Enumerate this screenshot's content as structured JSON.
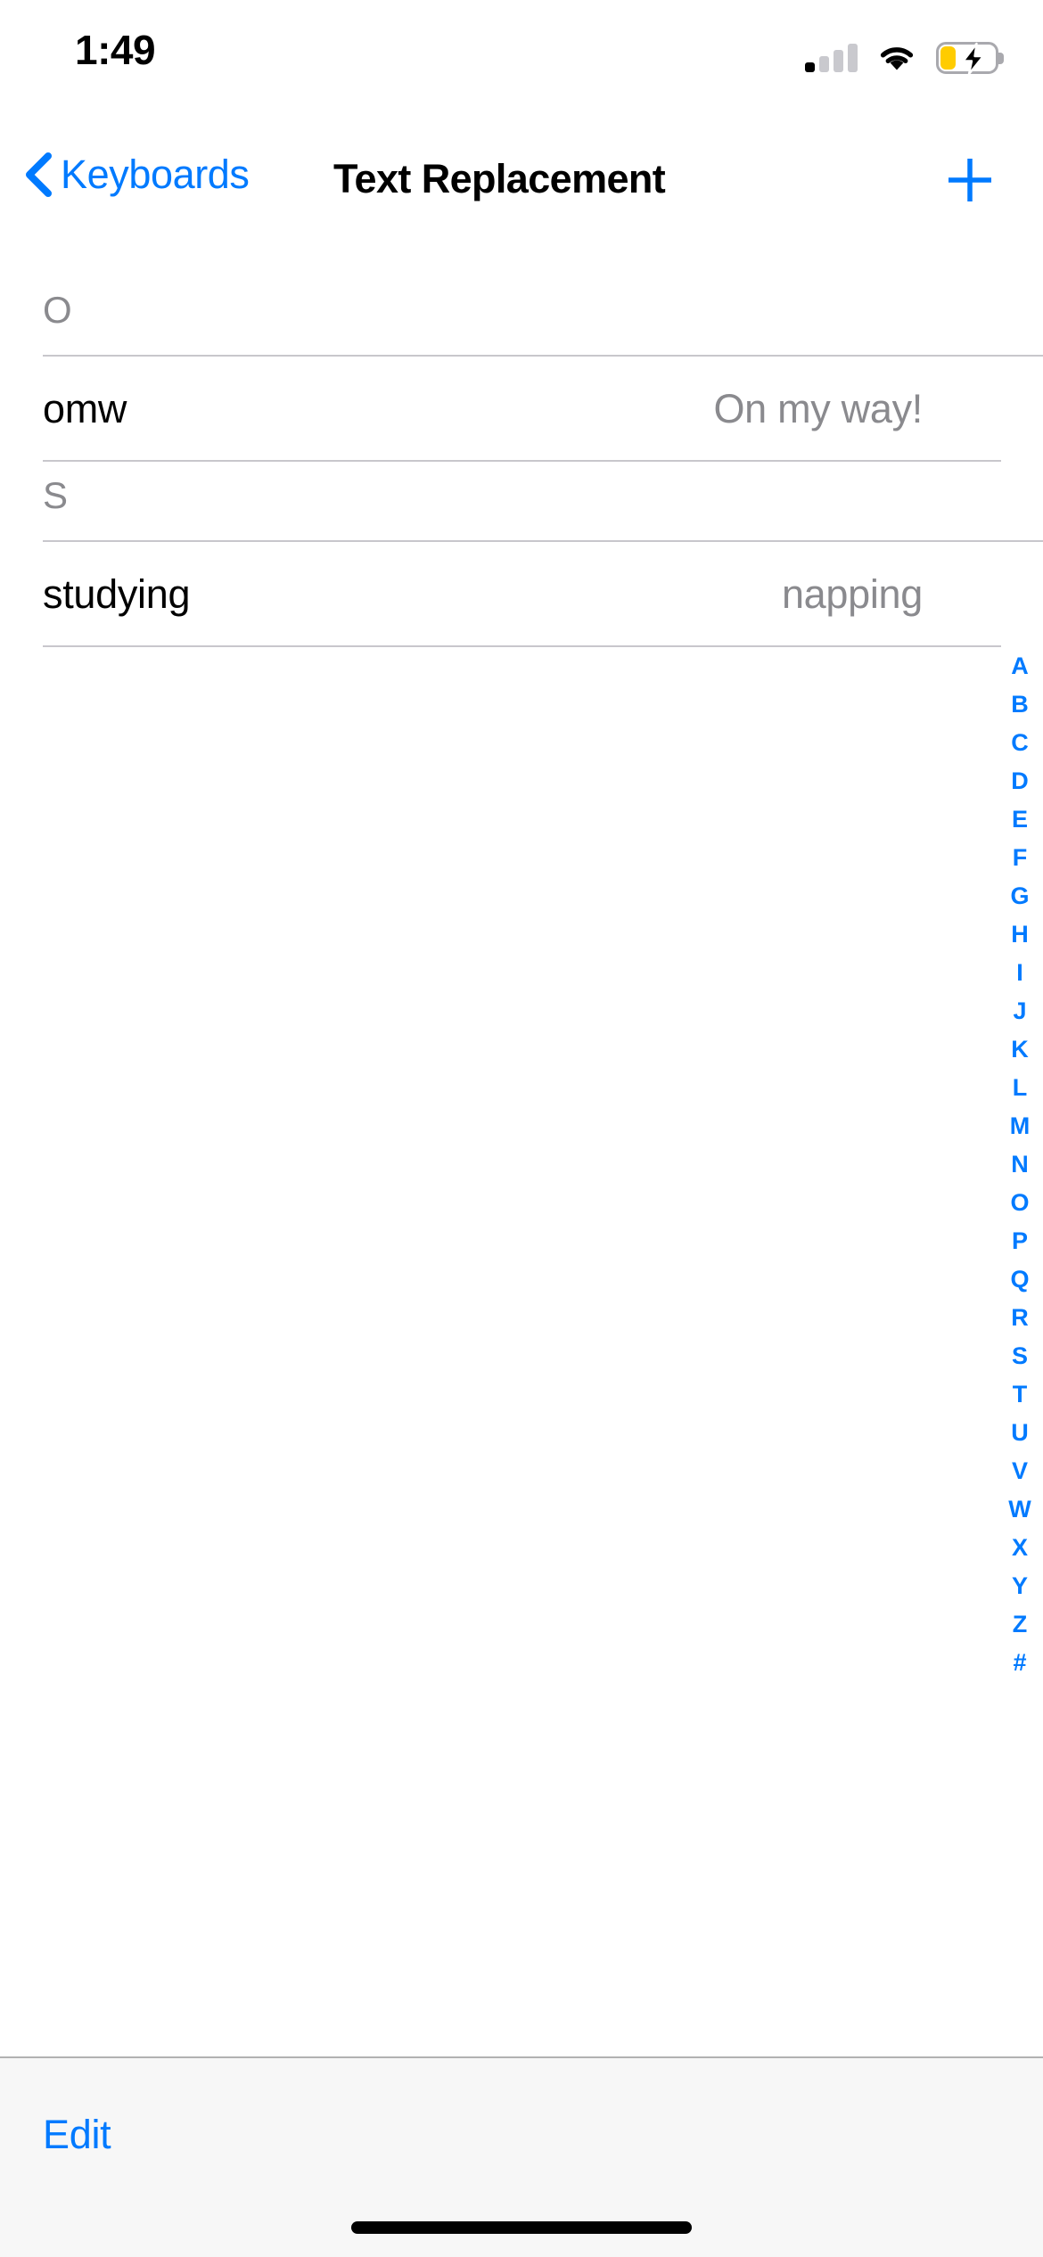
{
  "status_bar": {
    "time": "1:49",
    "cellular_icon": "cellular-signal-icon",
    "cellular_bars_filled": 1,
    "cellular_bars_total": 4,
    "wifi_icon": "wifi-icon",
    "battery_icon": "battery-charging-icon",
    "battery_low_power": true,
    "battery_fill_color": "#FFCC00",
    "battery_level_percent": 20
  },
  "nav": {
    "back_label": "Keyboards",
    "back_icon": "chevron-left-icon",
    "title": "Text Replacement",
    "add_icon": "plus-icon",
    "accent_color": "#007AFF"
  },
  "list": {
    "sections": [
      {
        "letter": "O",
        "rows": [
          {
            "shortcut": "omw",
            "phrase": "On my way!"
          }
        ]
      },
      {
        "letter": "S",
        "rows": [
          {
            "shortcut": "studying",
            "phrase": "napping"
          }
        ]
      }
    ]
  },
  "alpha_index": {
    "letters": [
      "A",
      "B",
      "C",
      "D",
      "E",
      "F",
      "G",
      "H",
      "I",
      "J",
      "K",
      "L",
      "M",
      "N",
      "O",
      "P",
      "Q",
      "R",
      "S",
      "T",
      "U",
      "V",
      "W",
      "X",
      "Y",
      "Z",
      "#"
    ]
  },
  "toolbar": {
    "edit_label": "Edit",
    "background_color": "#F7F7F7"
  },
  "home_indicator": {
    "label": "home-indicator"
  }
}
